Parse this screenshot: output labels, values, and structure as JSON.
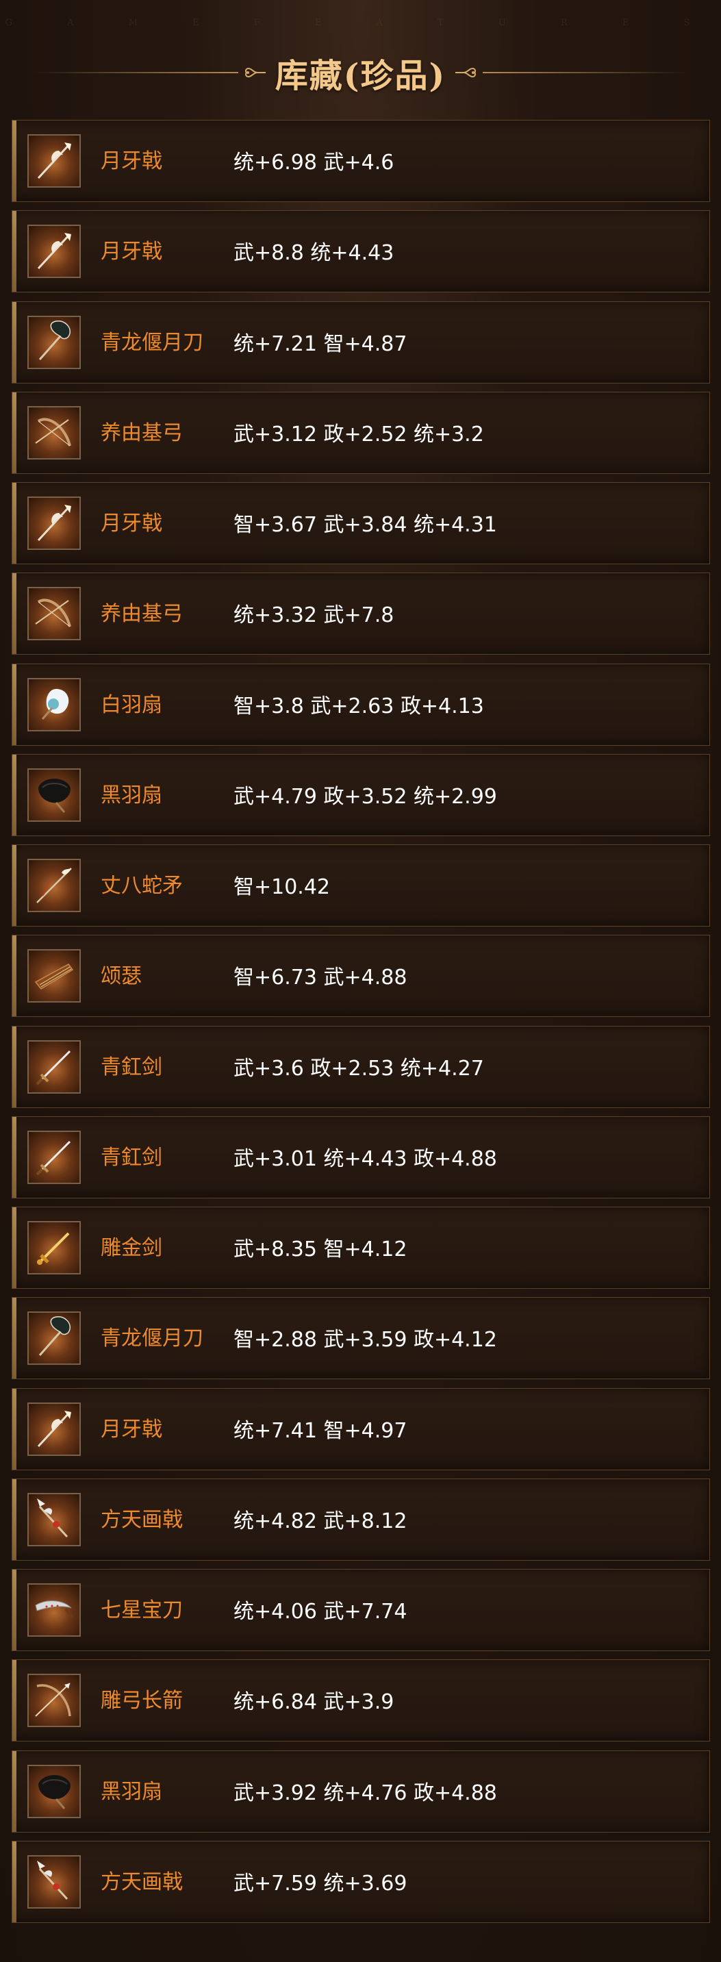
{
  "header": {
    "watermark": "G A M E   F E A T U R E S",
    "title": "库藏(珍品)"
  },
  "items": [
    {
      "name": "月牙戟",
      "stats": "统+6.98 武+4.6",
      "icon": "halberd-crescent-icon"
    },
    {
      "name": "月牙戟",
      "stats": "武+8.8 统+4.43",
      "icon": "halberd-crescent-icon"
    },
    {
      "name": "青龙偃月刀",
      "stats": "统+7.21 智+4.87",
      "icon": "guandao-blade-icon"
    },
    {
      "name": "养由基弓",
      "stats": "武+3.12 政+2.52 统+3.2",
      "icon": "bow-icon"
    },
    {
      "name": "月牙戟",
      "stats": "智+3.67 武+3.84 统+4.31",
      "icon": "halberd-crescent-icon"
    },
    {
      "name": "养由基弓",
      "stats": "统+3.32 武+7.8",
      "icon": "bow-icon"
    },
    {
      "name": "白羽扇",
      "stats": "智+3.8 武+2.63 政+4.13",
      "icon": "white-feather-fan-icon"
    },
    {
      "name": "黑羽扇",
      "stats": "武+4.79 政+3.52 统+2.99",
      "icon": "black-feather-fan-icon"
    },
    {
      "name": "丈八蛇矛",
      "stats": "智+10.42",
      "icon": "serpent-spear-icon"
    },
    {
      "name": "颂瑟",
      "stats": "智+6.73 武+4.88",
      "icon": "zither-icon"
    },
    {
      "name": "青釭剑",
      "stats": "武+3.6 政+2.53 统+4.27",
      "icon": "sword-icon"
    },
    {
      "name": "青釭剑",
      "stats": "武+3.01 统+4.43 政+4.88",
      "icon": "sword-icon"
    },
    {
      "name": "雕金剑",
      "stats": "武+8.35 智+4.12",
      "icon": "golden-sword-icon"
    },
    {
      "name": "青龙偃月刀",
      "stats": "智+2.88 武+3.59 政+4.12",
      "icon": "guandao-blade-icon"
    },
    {
      "name": "月牙戟",
      "stats": "统+7.41 智+4.97",
      "icon": "halberd-crescent-icon"
    },
    {
      "name": "方天画戟",
      "stats": "统+4.82 武+8.12",
      "icon": "painted-halberd-icon"
    },
    {
      "name": "七星宝刀",
      "stats": "统+4.06 武+7.74",
      "icon": "seven-star-sabre-icon"
    },
    {
      "name": "雕弓长箭",
      "stats": "统+6.84 武+3.9",
      "icon": "bow-arrow-icon"
    },
    {
      "name": "黑羽扇",
      "stats": "武+3.92 统+4.76 政+4.88",
      "icon": "black-feather-fan-icon"
    },
    {
      "name": "方天画戟",
      "stats": "武+7.59 统+3.69",
      "icon": "painted-halberd-icon"
    }
  ],
  "colors": {
    "item_name": "#ee8a2e",
    "item_stats": "#ffffff",
    "title": "#f3c88a",
    "row_border": "#5b412a",
    "accent_bar": "#b18a55"
  }
}
